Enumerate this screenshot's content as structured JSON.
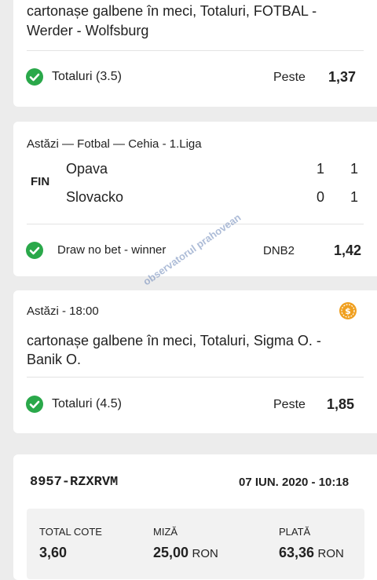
{
  "bets": [
    {
      "title_line1": "cartonașe galbene în meci, Totaluri, FOTBAL -",
      "title_line2": "Werder - Wolfsburg",
      "selection": "Totaluri (3.5)",
      "pick": "Peste",
      "odds": "1,37"
    },
    {
      "header": "Astăzi — Fotbal — Cehia - 1.Liga",
      "status": "FIN",
      "home_team": "Opava",
      "away_team": "Slovacko",
      "home_score_ht": "1",
      "home_score_ft": "1",
      "away_score_ht": "0",
      "away_score_ft": "1",
      "selection": "Draw no bet - winner",
      "pick": "DNB2",
      "odds": "1,42"
    },
    {
      "header": "Astăzi - 18:00",
      "title_line1": "cartonașe galbene în meci, Totaluri, Sigma O. -",
      "title_line2": "Banik O.",
      "selection": "Totaluri (4.5)",
      "pick": "Peste",
      "odds": "1,85"
    }
  ],
  "ticket": {
    "id": "8957-RZXRVM",
    "datetime": "07 IUN. 2020 - 10:18",
    "total_cote_label": "TOTAL COTE",
    "total_cote_value": "3,60",
    "miza_label": "MIZĂ",
    "miza_value": "25,00",
    "miza_currency": "RON",
    "plata_label": "PLATĂ",
    "plata_value": "63,36",
    "plata_currency": "RON"
  },
  "watermark": "observatorul prahovean",
  "colors": {
    "check_green": "#2aa84a",
    "coin_orange": "#f0a020",
    "page_bg": "#ececec"
  }
}
